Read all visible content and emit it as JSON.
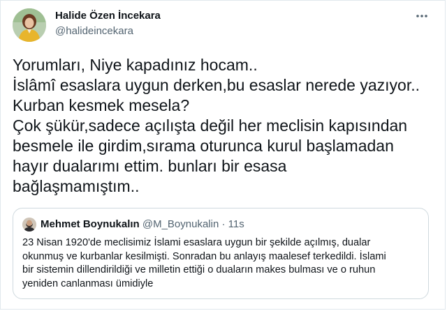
{
  "author": {
    "name": "Halide Özen İncekara",
    "handle": "@halideincekara"
  },
  "icons": {
    "more": "more-options-icon"
  },
  "tweet": {
    "text": "Yorumları, Niye kapadınız hocam..\nİslâmî esaslara uygun derken,bu esaslar nerede yazıyor..\nKurban kesmek mesela?\nÇok şükür,sadece açılışta değil her meclisin kapısından\nbesmele ile girdim,sırama oturunca kurul başlamadan\nhayır dualarımı ettim. bunları bir esasa\nbağlaşmamıştım.."
  },
  "quoted_tweet": {
    "name": "Mehmet Boynukalın",
    "handle": "@M_Boynukalin",
    "separator": "·",
    "time": "11s",
    "text": "23 Nisan 1920'de meclisimiz İslami esaslara uygun bir şekilde açılmış, dualar\nokunmuş ve kurbanlar kesilmişti. Sonradan bu anlayış maalesef terkedildi. İslami\nbir sistemin dillendirildiği ve milletin ettiği o duaların makes bulması ve o ruhun\nyeniden canlanması ümidiyle"
  },
  "colors": {
    "text_primary": "#0f1419",
    "text_secondary": "#536471",
    "border": "#cfd9de"
  }
}
